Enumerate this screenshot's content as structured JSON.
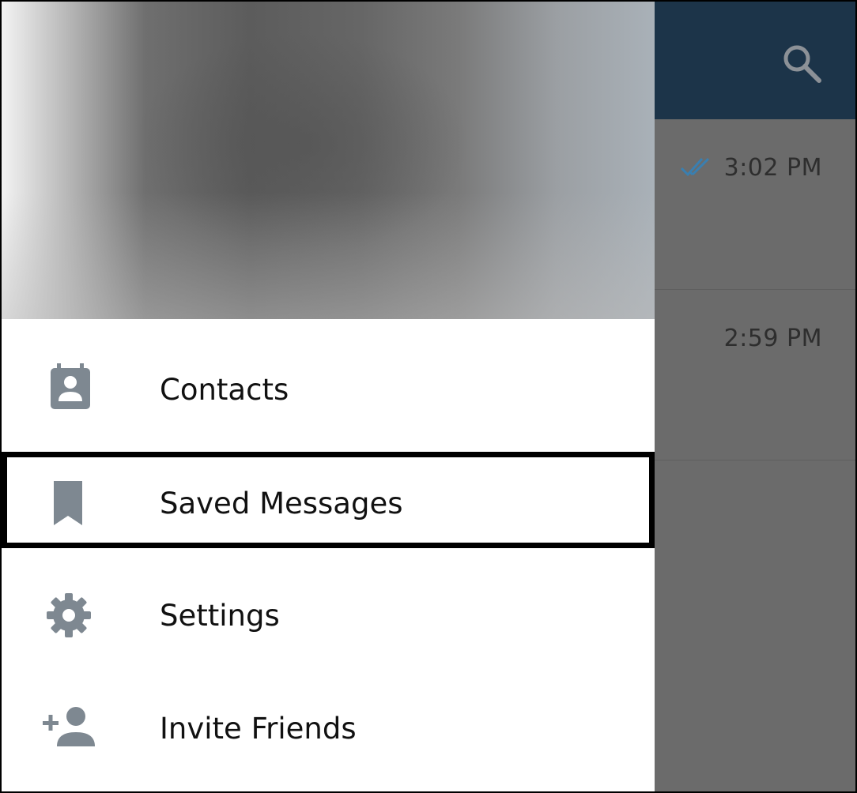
{
  "colors": {
    "header_bar": "#1c3449",
    "overlay_list": "#6b6b6b",
    "drawer_bg": "#ffffff",
    "icon_gray": "#7e8891",
    "read_ticks": "#3a7fb0",
    "highlight_border": "#000000"
  },
  "header": {
    "search_icon": "search-icon"
  },
  "chats": [
    {
      "time": "3:02 PM",
      "read_status": "double-check-icon"
    },
    {
      "time": "2:59 PM"
    }
  ],
  "drawer": {
    "menu": [
      {
        "label": "Contacts",
        "icon": "contact-card-icon"
      },
      {
        "label": "Saved Messages",
        "icon": "bookmark-icon",
        "highlighted": true
      },
      {
        "label": "Settings",
        "icon": "gear-icon"
      },
      {
        "label": "Invite Friends",
        "icon": "person-add-icon"
      }
    ]
  }
}
